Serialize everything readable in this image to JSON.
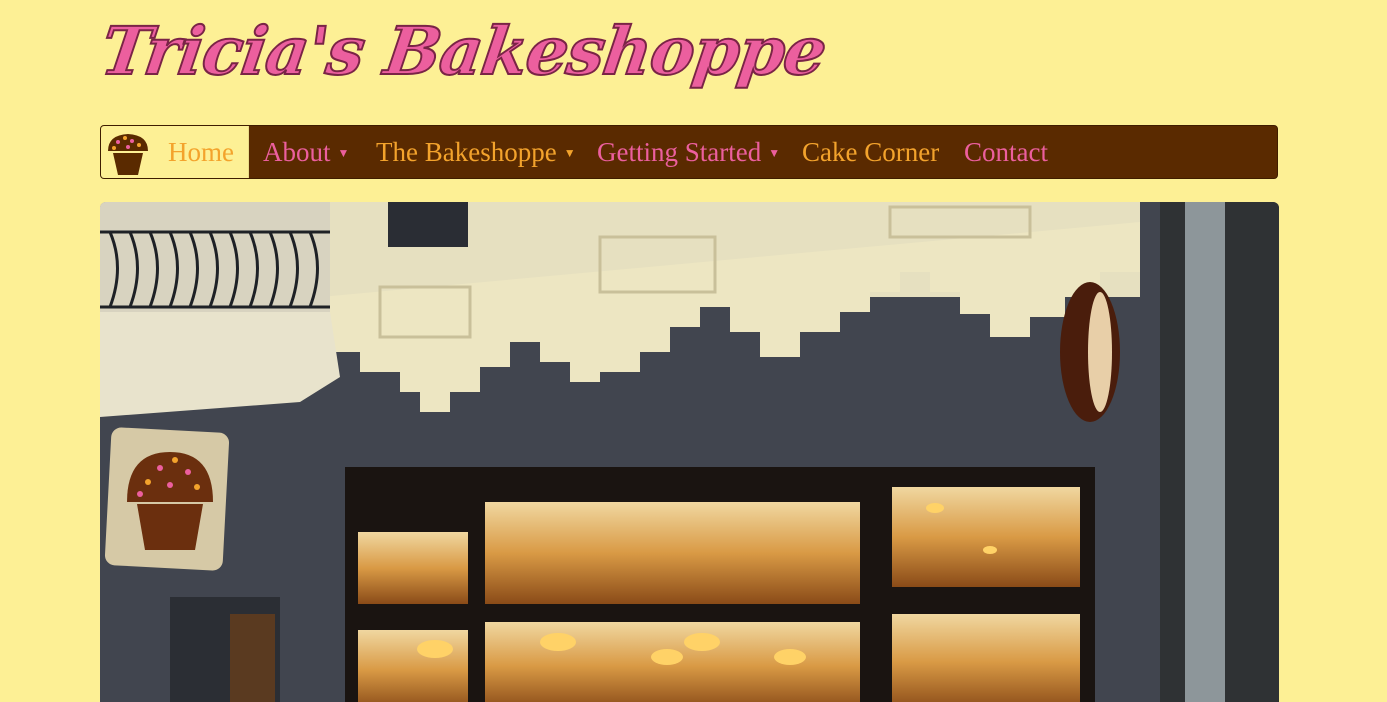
{
  "brand": {
    "logo_text": "Tricia's Bakeshoppe"
  },
  "nav": {
    "home_icon": "cupcake-icon",
    "items": [
      {
        "label": "Home",
        "active": true,
        "dropdown": false
      },
      {
        "label": "About",
        "dropdown": true
      },
      {
        "label": "The Bakeshoppe",
        "dropdown": true
      },
      {
        "label": "Getting Started",
        "dropdown": true
      },
      {
        "label": "Cake Corner",
        "dropdown": false
      },
      {
        "label": "Contact",
        "dropdown": false
      }
    ],
    "caret_icon": "caret-down-icon"
  },
  "hero": {
    "image": "bakeshop-storefront-photo",
    "sign_icon": "cupcake-sign-icon"
  },
  "colors": {
    "page_bg": "#fdf095",
    "nav_bg": "#5a2a00",
    "pink": "#ec5f9e",
    "orange": "#f3a32c"
  }
}
